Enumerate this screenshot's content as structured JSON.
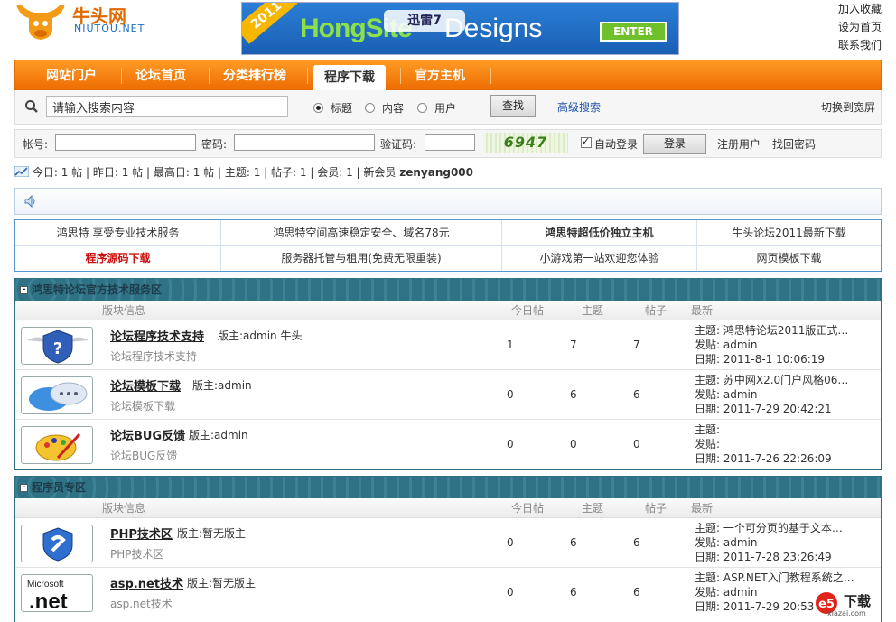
{
  "header": {
    "logo_text": "牛头网",
    "logo_sub": "NIUTOU.NET",
    "banner": {
      "ribbon": "2011",
      "xunlei": "迅雷7",
      "brand_green": "HongSite",
      "brand_white": "Designs",
      "enter": "ENTER"
    },
    "top_links": [
      "加入收藏",
      "设为首页",
      "联系我们"
    ]
  },
  "nav": {
    "tabs": [
      "网站门户",
      "论坛首页",
      "分类排行榜",
      "程序下载",
      "官方主机"
    ],
    "active": "程序下载"
  },
  "search": {
    "value": "请输入搜索内容",
    "options": [
      "标题",
      "内容",
      "用户"
    ],
    "selected": "标题",
    "button": "查找",
    "advanced": "高级搜索",
    "wide": "切换到宽屏"
  },
  "login": {
    "account_label": "帐号:",
    "password_label": "密码:",
    "captcha_label": "验证码:",
    "captcha_text": "6947",
    "auto_login": "自动登录",
    "login_button": "登录",
    "register": "注册用户",
    "recover": "找回密码"
  },
  "stats": {
    "today_label": "今日:",
    "today": "1 帖",
    "yesterday_label": "昨日:",
    "yesterday": "1 帖",
    "max_label": "最高日:",
    "max": "1 帖",
    "topics_label": "主题:",
    "topics": "1",
    "posts_label": "帖子:",
    "posts": "1",
    "members_label": "会员:",
    "members": "1",
    "newest_label": "新会员",
    "newest": "zenyang000"
  },
  "links": [
    [
      "鸿思特 享受专业技术服务",
      "鸿思特空间高速稳定安全、域名78元",
      "鸿思特超低价独立主机",
      "牛头论坛2011最新下载"
    ],
    [
      "程序源码下载",
      "服务器托管与租用(免费无限重装)",
      "小游戏第一站欢迎您体验",
      "网页模板下载"
    ]
  ],
  "columns": {
    "info": "版块信息",
    "today": "今日帖",
    "topic": "主题",
    "post": "帖子",
    "latest": "最新"
  },
  "sections": [
    {
      "title": "鸿思特论坛官方技术服务区",
      "rows": [
        {
          "name": "论坛程序技术支持",
          "mod": "版主:admin  牛头",
          "desc": "论坛程序技术支持",
          "today": "1",
          "topics": "7",
          "posts": "7",
          "last_topic": "主题: 鸿思特论坛2011版正式…",
          "last_poster": "发贴: admin",
          "last_date": "日期: 2011-8-1 10:06:19"
        },
        {
          "name": "论坛模板下载",
          "mod": "版主:admin",
          "desc": "论坛模板下载",
          "today": "0",
          "topics": "6",
          "posts": "6",
          "last_topic": "主题: 苏中网X2.0门户风格06…",
          "last_poster": "发贴: admin",
          "last_date": "日期: 2011-7-29 20:42:21"
        },
        {
          "name": "论坛BUG反馈",
          "mod": "版主:admin",
          "desc": "论坛BUG反馈",
          "today": "0",
          "topics": "0",
          "posts": "0",
          "last_topic": "主题:",
          "last_poster": "发贴:",
          "last_date": "日期: 2011-7-26 22:26:09"
        }
      ]
    },
    {
      "title": "程序员专区",
      "rows": [
        {
          "name": "PHP技术区",
          "mod": "版主:暂无版主",
          "desc": "PHP技术区",
          "today": "0",
          "topics": "6",
          "posts": "6",
          "last_topic": "主题: 一个可分页的基于文本…",
          "last_poster": "发贴: admin",
          "last_date": "日期: 2011-7-28 23:26:49"
        },
        {
          "name": "asp.net技术",
          "mod": "版主:暂无版主",
          "desc": "asp.net技术",
          "today": "0",
          "topics": "6",
          "posts": "6",
          "last_topic": "主题: ASP.NET入门教程系统之…",
          "last_poster": "发贴: admin",
          "last_date": "日期: 2011-7-29 20:53"
        }
      ]
    }
  ],
  "watermark": {
    "text": "下载",
    "sub": "xiazai.com"
  },
  "colors": {
    "nav_orange": "#f2780a",
    "section_teal": "#2f7286",
    "link_blue": "#2255aa",
    "red": "#cc1111"
  }
}
